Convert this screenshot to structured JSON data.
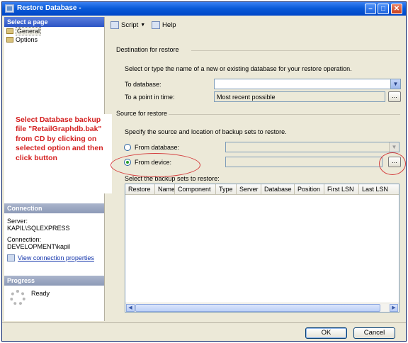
{
  "window": {
    "title": "Restore Database -"
  },
  "left": {
    "select_page": "Select a page",
    "pages": [
      "General",
      "Options"
    ],
    "annotation": "Select Database backup file \"RetailGraphdb.bak\" from CD by clicking on selected option and then click button",
    "connection": {
      "header": "Connection",
      "server_label": "Server:",
      "server_value": "KAPIL\\SQLEXPRESS",
      "connection_label": "Connection:",
      "connection_value": "DEVELOPMENT\\kapil",
      "link": "View connection properties"
    },
    "progress": {
      "header": "Progress",
      "status": "Ready"
    }
  },
  "toolbar": {
    "script": "Script",
    "help": "Help"
  },
  "destination": {
    "header": "Destination for restore",
    "desc": "Select or type the name of a new or existing database for your restore operation.",
    "to_database_label": "To database:",
    "to_database_value": "",
    "point_in_time_label": "To a point in time:",
    "point_in_time_value": "Most recent possible"
  },
  "source": {
    "header": "Source for restore",
    "desc": "Specify the source and location of backup sets to restore.",
    "from_database": "From database:",
    "from_device": "From device:",
    "selected": "from_device",
    "browse": "...",
    "backup_sets_label": "Select the backup sets to restore:",
    "columns": [
      "Restore",
      "Name",
      "Component",
      "Type",
      "Server",
      "Database",
      "Position",
      "First LSN",
      "Last LSN"
    ]
  },
  "footer": {
    "ok": "OK",
    "cancel": "Cancel"
  },
  "colors": {
    "title_bar": "#0a5bd8",
    "section_header": "#2c55c5",
    "annotation": "#d41f1f"
  }
}
